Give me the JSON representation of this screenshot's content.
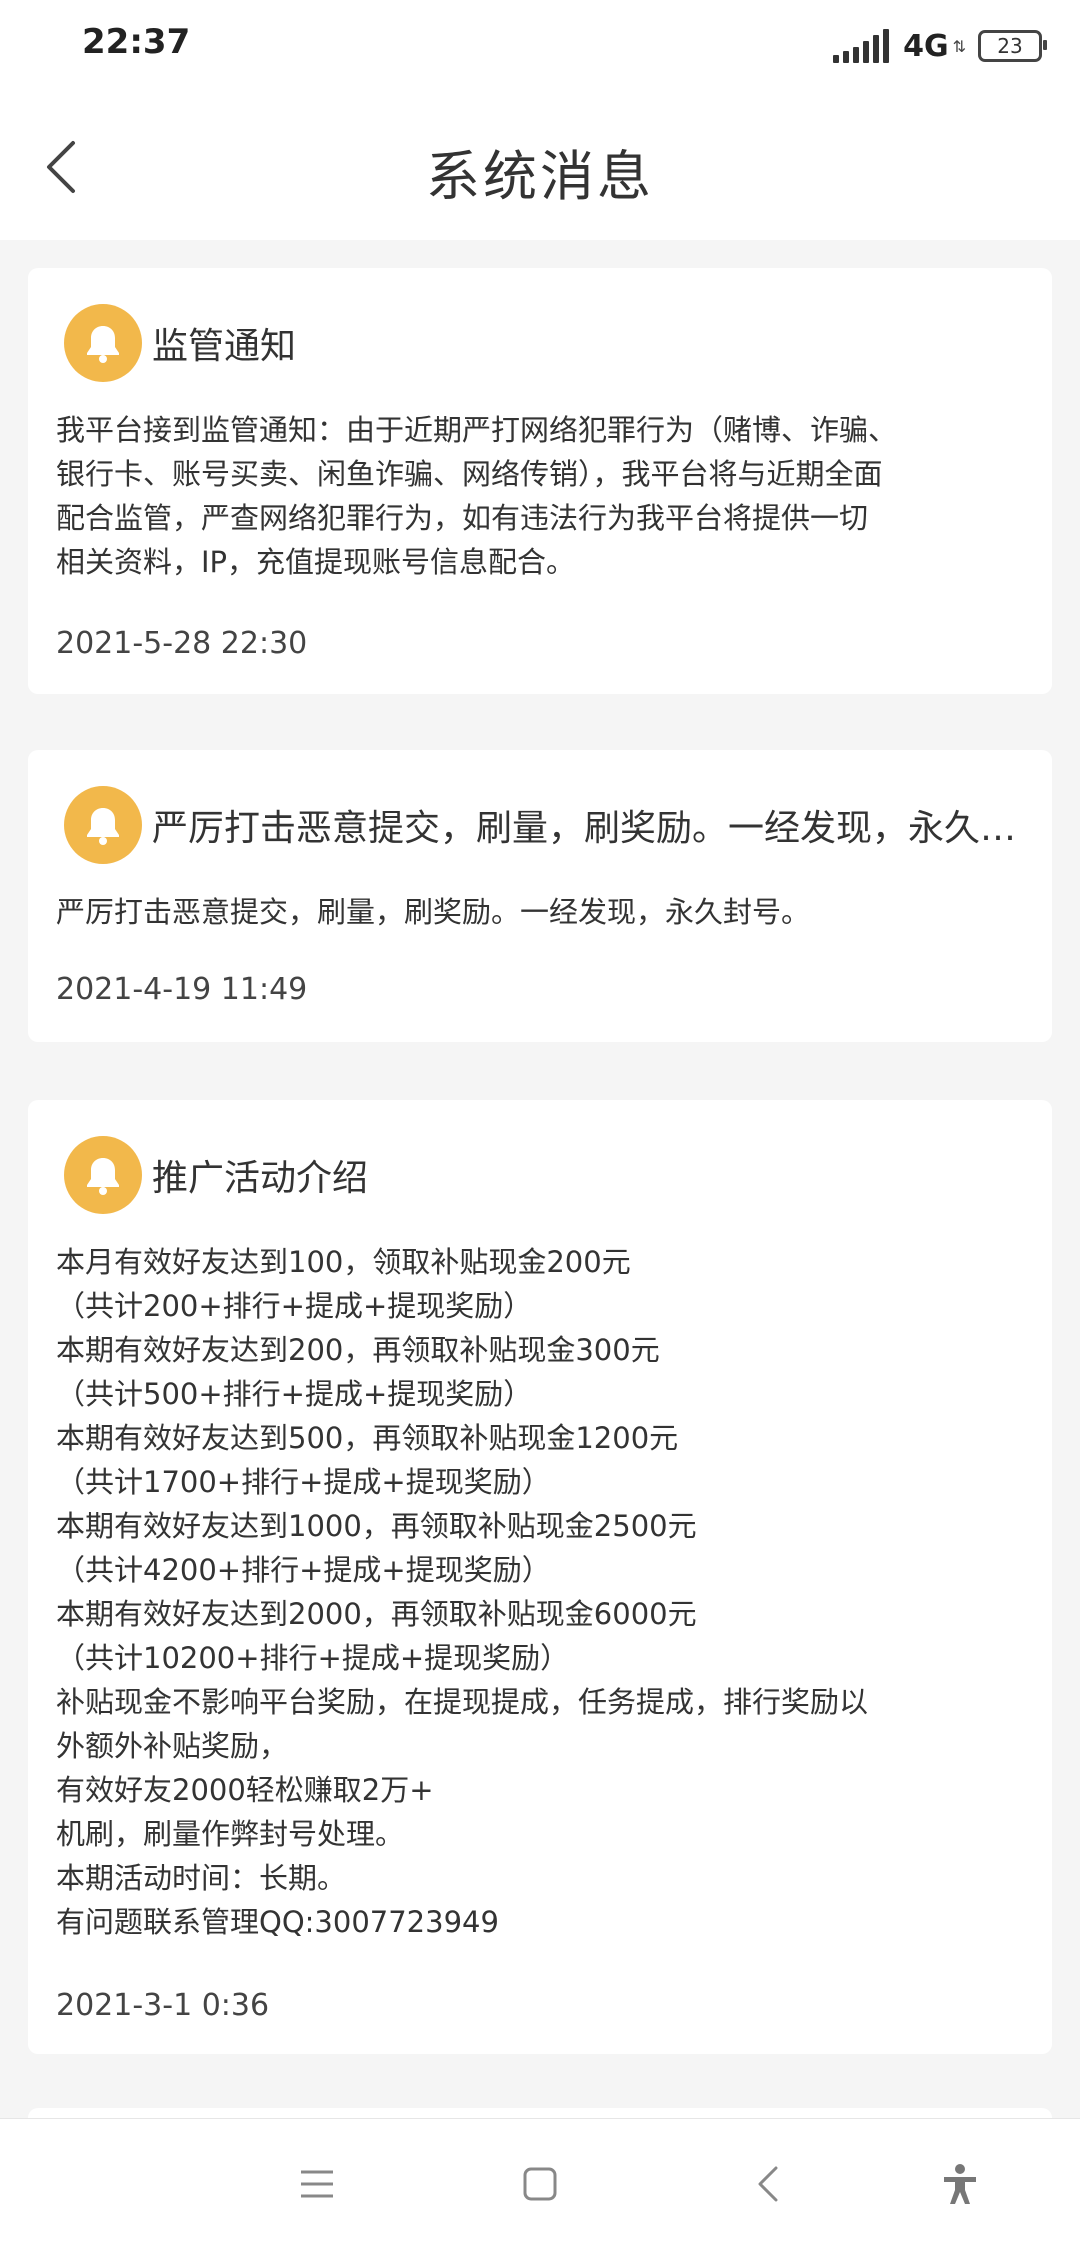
{
  "status_bar": {
    "time": "22:37",
    "network": "4G",
    "battery": "23",
    "signal_icon": "signal-icon"
  },
  "header": {
    "title": "系统消息",
    "back_icon": "back-chevron-icon"
  },
  "messages": [
    {
      "title": "监管通知",
      "body": "我平台接到监管通知：由于近期严打网络犯罪行为（赌博、诈骗、\n银行卡、账号买卖、闲鱼诈骗、网络传销），我平台将与近期全面\n配合监管，严查网络犯罪行为，如有违法行为我平台将提供一切\n相关资料，IP，充值提现账号信息配合。",
      "time": "2021-5-28 22:30"
    },
    {
      "title": "严厉打击恶意提交，刷量，刷奖励。一经发现，永久封...",
      "body": "严厉打击恶意提交，刷量，刷奖励。一经发现，永久封号。",
      "time": "2021-4-19 11:49"
    },
    {
      "title": "推广活动介绍",
      "body": "本月有效好友达到100，领取补贴现金200元\n（共计200+排行+提成+提现奖励）\n本期有效好友达到200，再领取补贴现金300元\n（共计500+排行+提成+提现奖励）\n本期有效好友达到500，再领取补贴现金1200元\n（共计1700+排行+提成+提现奖励）\n本期有效好友达到1000，再领取补贴现金2500元\n（共计4200+排行+提成+提现奖励）\n本期有效好友达到2000，再领取补贴现金6000元\n（共计10200+排行+提成+提现奖励）\n补贴现金不影响平台奖励，在提现提成，任务提成，排行奖励以\n外额外补贴奖励，\n有效好友2000轻松赚取2万+\n 机刷，刷量作弊封号处理。\n本期活动时间：长期。\n有问题联系管理QQ:3007723949",
      "time": "2021-3-1 0:36"
    }
  ],
  "colors": {
    "bell_bg": "#f2b84b",
    "page_bg": "#f5f5f5"
  },
  "nav": {
    "menu_icon": "menu-icon",
    "home_icon": "home-square-icon",
    "back_icon": "nav-back-icon",
    "accessibility_icon": "accessibility-icon"
  }
}
